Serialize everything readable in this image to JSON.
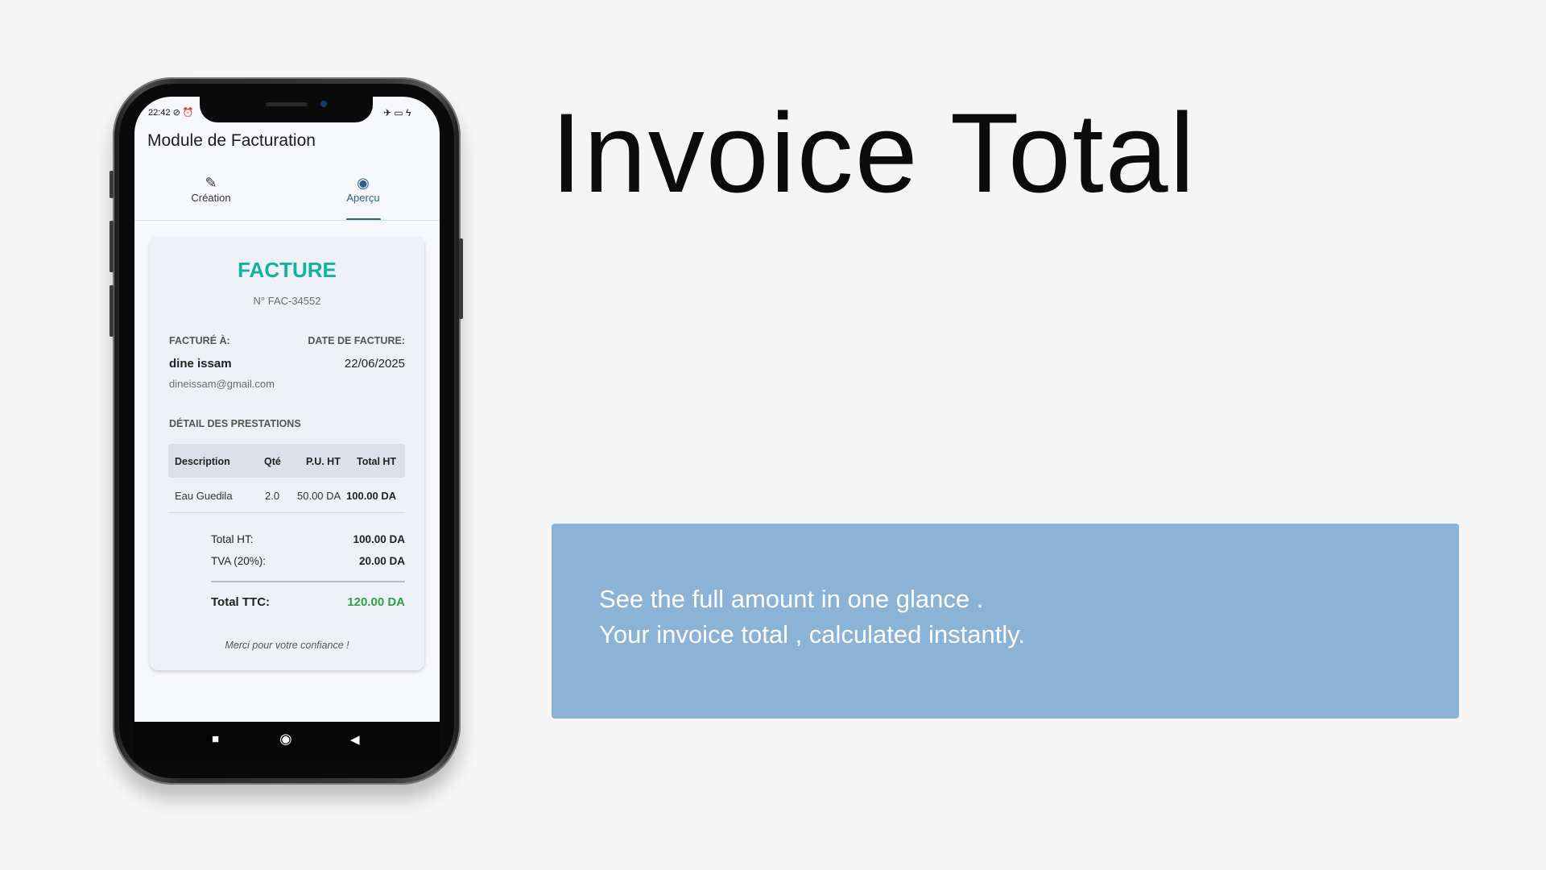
{
  "headline": "Invoice Total",
  "info": {
    "line1": "See the full amount in one glance .",
    "line2": "Your invoice total , calculated instantly."
  },
  "phone": {
    "status": {
      "time": "22:42",
      "left_icons": "⊘ ⏰",
      "right_icons": "✈ ▭ ϟ"
    },
    "app_title": "Module de Facturation",
    "tabs": [
      {
        "label": "Création",
        "icon": "pencil-icon",
        "glyph": "✎"
      },
      {
        "label": "Aperçu",
        "icon": "eye-icon",
        "glyph": "◉",
        "active": true
      }
    ],
    "invoice": {
      "title": "FACTURE",
      "number": "N° FAC-34552",
      "billed_to_label": "FACTURÉ À:",
      "client_name": "dine issam",
      "client_email": "dineissam@gmail.com",
      "date_label": "DATE DE FACTURE:",
      "date": "22/06/2025",
      "details_label": "DÉTAIL DES PRESTATIONS",
      "columns": [
        "Description",
        "Qté",
        "P.U. HT",
        "Total HT"
      ],
      "rows": [
        {
          "description": "Eau Guedila",
          "qty": "2.0",
          "unit_price": "50.00 DA",
          "total": "100.00 DA"
        }
      ],
      "total_ht_label": "Total HT:",
      "total_ht": "100.00 DA",
      "tva_label": "TVA (20%):",
      "tva": "20.00 DA",
      "total_ttc_label": "Total TTC:",
      "total_ttc": "120.00 DA",
      "thanks": "Merci pour votre confiance !"
    },
    "nav": {
      "recent": "■",
      "home": "◉",
      "back": "◀"
    }
  },
  "colors": {
    "accent_teal": "#12b39c",
    "total_green": "#2ea043",
    "tab_active": "#2c5d8f",
    "info_box": "#8bb3d7"
  }
}
